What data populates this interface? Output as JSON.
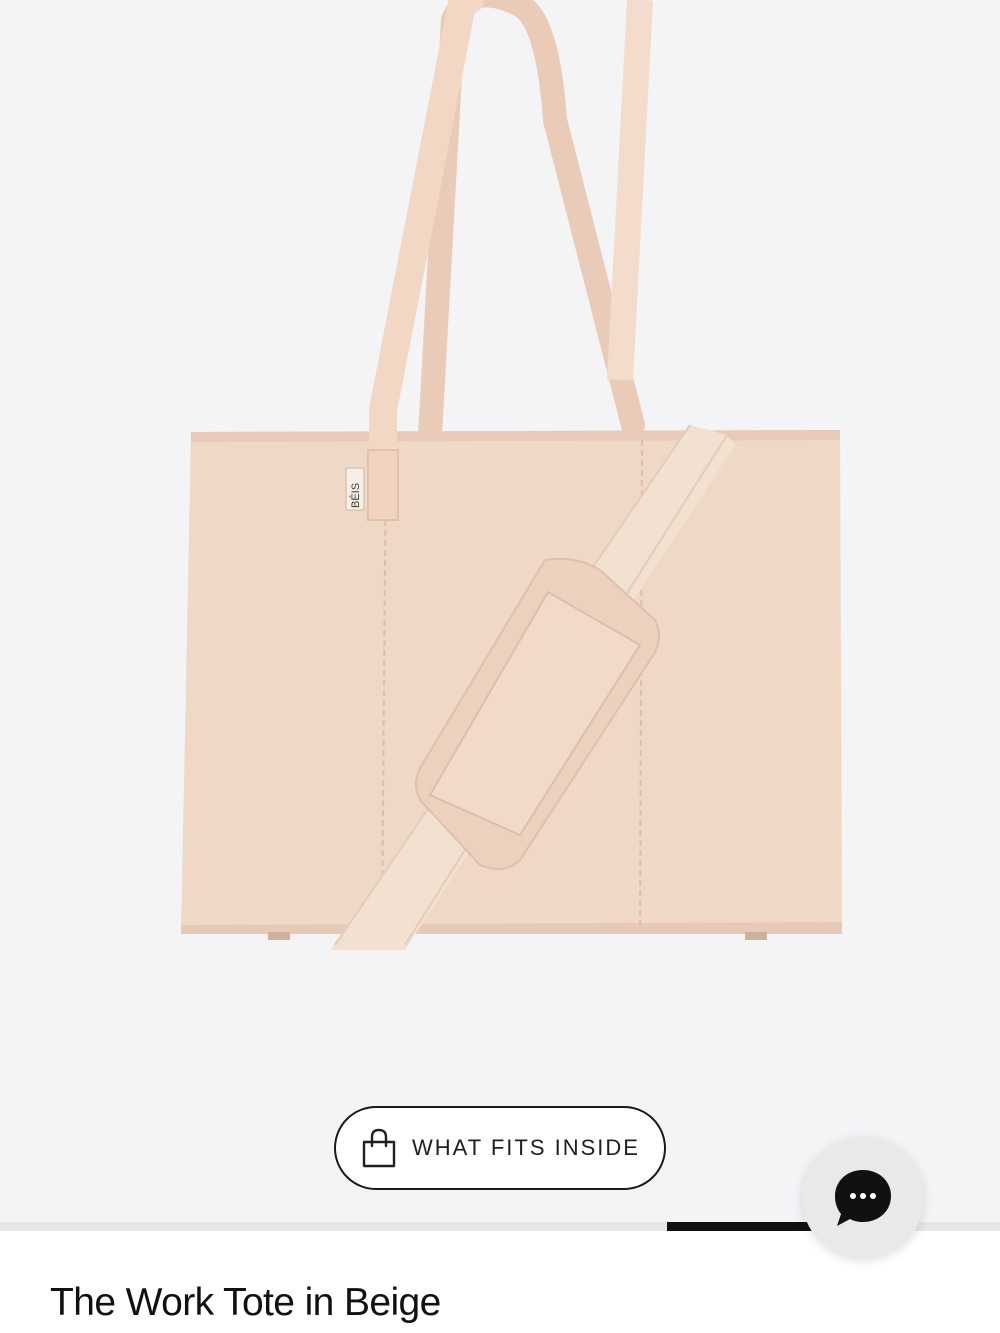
{
  "product": {
    "title": "The Work Tote in Beige",
    "brand_tag": "BÉIS",
    "color": "#f0d8c6",
    "strap_color": "#f2e1d0"
  },
  "gallery": {
    "background": "#f4f3f6",
    "progress": {
      "start": 0.667,
      "end": 0.812
    }
  },
  "what_fits_button": {
    "label": "WHAT FITS INSIDE",
    "icon": "shopping-bag-icon"
  },
  "chat_button": {
    "icon": "chat-bubble-icon"
  }
}
